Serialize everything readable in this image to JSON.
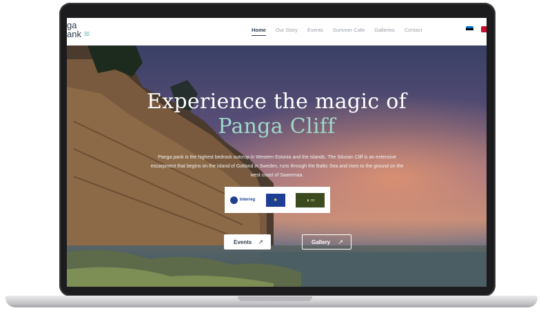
{
  "logo": {
    "line1": "ga",
    "line2": "ank",
    "waves": "≋"
  },
  "nav": {
    "items": [
      "Home",
      "Our Story",
      "Events",
      "Summer Cafe",
      "Galleries",
      "Contact"
    ],
    "active": "Home"
  },
  "hero": {
    "title_line1": "Experience the magic of",
    "title_line2": "Panga Cliff",
    "description": "Panga pank is the highest bedrock outcrop in Western Estonia and the islands. The Silurian Cliff is an extensive escarpment that begins on the island of Gotland in Sweden, runs through the Baltic Sea and rises to the ground on the west coast of Saaremaa."
  },
  "partner_logos": {
    "interreg_label": "interreg"
  },
  "buttons": {
    "events_label": "Events",
    "gallery_label": "Gallery",
    "arrow": "↗"
  },
  "colors": {
    "accent": "#9fd8c8",
    "nav_text": "#2e3b4e"
  },
  "icons": [
    "estonia-flag-icon",
    "uk-flag-icon",
    "arrow-up-right-icon",
    "eu-flag-icon"
  ]
}
